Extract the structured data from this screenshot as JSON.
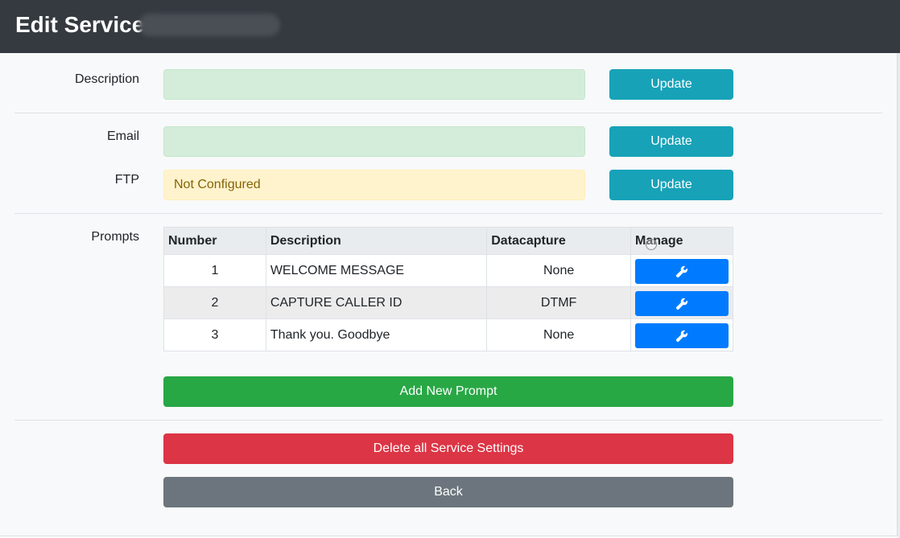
{
  "header": {
    "title": "Edit Service"
  },
  "form": {
    "description_label": "Description",
    "description_value": "",
    "description_update": "Update",
    "email_label": "Email",
    "email_value": "",
    "email_update": "Update",
    "ftp_label": "FTP",
    "ftp_value": "Not Configured",
    "ftp_update": "Update"
  },
  "prompts": {
    "label": "Prompts",
    "columns": [
      "Number",
      "Description",
      "Datacapture",
      "Manage"
    ],
    "rows": [
      {
        "number": "1",
        "description": "WELCOME MESSAGE",
        "datacapture": "None",
        "manage_icon": "wrench-icon"
      },
      {
        "number": "2",
        "description": "CAPTURE CALLER ID",
        "datacapture": "DTMF",
        "manage_icon": "wrench-icon"
      },
      {
        "number": "3",
        "description": "Thank you. Goodbye",
        "datacapture": "None",
        "manage_icon": "wrench-icon"
      }
    ],
    "add_button": "Add New Prompt"
  },
  "actions": {
    "delete_button": "Delete all Service Settings",
    "back_button": "Back"
  },
  "colors": {
    "header_bg": "#343a40",
    "info": "#17a2b8",
    "primary": "#007bff",
    "success": "#28a745",
    "danger": "#dc3545",
    "secondary": "#6c757d",
    "field_success_bg": "#d4edda",
    "field_warning_bg": "#fff3cd"
  }
}
